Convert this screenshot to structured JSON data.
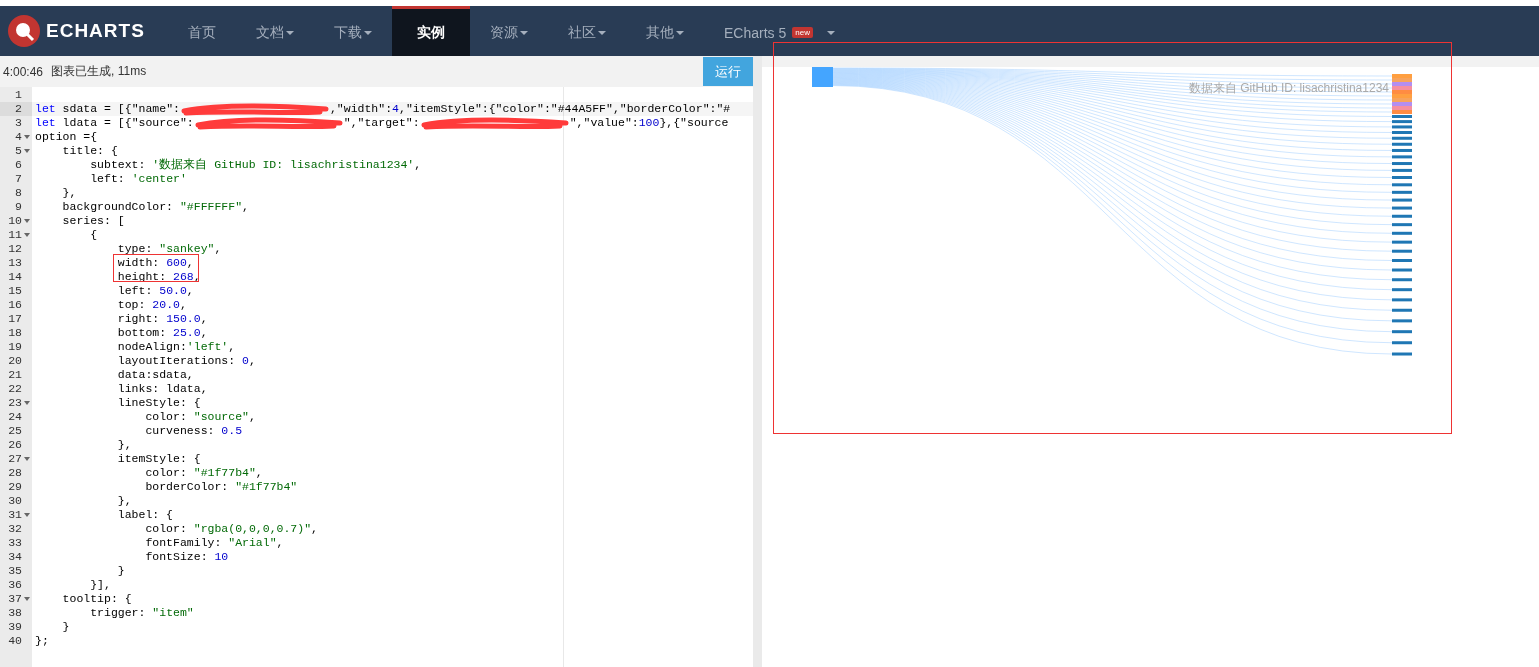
{
  "nav": {
    "logo": "ECHARTS",
    "items": [
      {
        "label": "首页",
        "dropdown": false,
        "selected": false
      },
      {
        "label": "文档",
        "dropdown": true,
        "selected": false
      },
      {
        "label": "下载",
        "dropdown": true,
        "selected": false
      },
      {
        "label": "实例",
        "dropdown": false,
        "selected": true
      },
      {
        "label": "资源",
        "dropdown": true,
        "selected": false
      },
      {
        "label": "社区",
        "dropdown": true,
        "selected": false
      },
      {
        "label": "其他",
        "dropdown": true,
        "selected": false
      },
      {
        "label": "ECharts 5",
        "badge": "new",
        "dropdown": true,
        "selected": false
      }
    ]
  },
  "status": {
    "time": "4:00:46",
    "message": "图表已生成, 11ms",
    "run_button": "运行"
  },
  "editor": {
    "lines": [
      {
        "n": "1",
        "fold": false,
        "active": false
      },
      {
        "n": "2",
        "fold": false,
        "active": true,
        "tokens": [
          {
            "kind": "kw",
            "text": "let"
          },
          {
            "kind": "plain",
            "text": " sdata = [{\"name\":"
          },
          {
            "kind": "redacted"
          },
          {
            "kind": "plain",
            "text": ",\"width\":"
          },
          {
            "kind": "num",
            "text": "4"
          },
          {
            "kind": "plain",
            "text": ",\"itemStyle\":{\"color\":\"#44A5FF\",\"borderColor\":\"#"
          }
        ]
      },
      {
        "n": "3",
        "fold": false,
        "active": false,
        "tokens": [
          {
            "kind": "kw",
            "text": "let"
          },
          {
            "kind": "plain",
            "text": " ldata = [{\"source\":"
          },
          {
            "kind": "redacted"
          },
          {
            "kind": "plain",
            "text": "\",\"target\":"
          },
          {
            "kind": "redacted"
          },
          {
            "kind": "plain",
            "text": "\",\"value\":"
          },
          {
            "kind": "num",
            "text": "100"
          },
          {
            "kind": "plain",
            "text": "},{\"source"
          }
        ]
      },
      {
        "n": "4",
        "fold": true,
        "active": false,
        "tokens": [
          {
            "kind": "plain",
            "text": "option ={"
          }
        ]
      },
      {
        "n": "5",
        "fold": true,
        "active": false,
        "tokens": [
          {
            "kind": "plain",
            "text": "    title: {"
          }
        ]
      },
      {
        "n": "6",
        "fold": false,
        "active": false,
        "tokens": [
          {
            "kind": "plain",
            "text": "        subtext: "
          },
          {
            "kind": "str",
            "text": "'数据来自 GitHub ID: lisachristina1234'"
          },
          {
            "kind": "plain",
            "text": ","
          }
        ]
      },
      {
        "n": "7",
        "fold": false,
        "active": false,
        "tokens": [
          {
            "kind": "plain",
            "text": "        left: "
          },
          {
            "kind": "str",
            "text": "'center'"
          }
        ]
      },
      {
        "n": "8",
        "fold": false,
        "active": false,
        "tokens": [
          {
            "kind": "plain",
            "text": "    },"
          }
        ]
      },
      {
        "n": "9",
        "fold": false,
        "active": false,
        "tokens": [
          {
            "kind": "plain",
            "text": "    backgroundColor: "
          },
          {
            "kind": "str",
            "text": "\"#FFFFFF\""
          },
          {
            "kind": "plain",
            "text": ","
          }
        ]
      },
      {
        "n": "10",
        "fold": true,
        "active": false,
        "tokens": [
          {
            "kind": "plain",
            "text": "    series: ["
          }
        ]
      },
      {
        "n": "11",
        "fold": true,
        "active": false,
        "tokens": [
          {
            "kind": "plain",
            "text": "        {"
          }
        ]
      },
      {
        "n": "12",
        "fold": false,
        "active": false,
        "tokens": [
          {
            "kind": "plain",
            "text": "            type: "
          },
          {
            "kind": "str",
            "text": "\"sankey\""
          },
          {
            "kind": "plain",
            "text": ","
          }
        ]
      },
      {
        "n": "13",
        "fold": false,
        "active": false,
        "tokens": [
          {
            "kind": "plain",
            "text": "            width: "
          },
          {
            "kind": "num",
            "text": "600"
          },
          {
            "kind": "plain",
            "text": ","
          }
        ]
      },
      {
        "n": "14",
        "fold": false,
        "active": false,
        "tokens": [
          {
            "kind": "plain",
            "text": "            height: "
          },
          {
            "kind": "num",
            "text": "268"
          },
          {
            "kind": "plain",
            "text": ","
          }
        ]
      },
      {
        "n": "15",
        "fold": false,
        "active": false,
        "tokens": [
          {
            "kind": "plain",
            "text": "            left: "
          },
          {
            "kind": "num",
            "text": "50.0"
          },
          {
            "kind": "plain",
            "text": ","
          }
        ]
      },
      {
        "n": "16",
        "fold": false,
        "active": false,
        "tokens": [
          {
            "kind": "plain",
            "text": "            top: "
          },
          {
            "kind": "num",
            "text": "20.0"
          },
          {
            "kind": "plain",
            "text": ","
          }
        ]
      },
      {
        "n": "17",
        "fold": false,
        "active": false,
        "tokens": [
          {
            "kind": "plain",
            "text": "            right: "
          },
          {
            "kind": "num",
            "text": "150.0"
          },
          {
            "kind": "plain",
            "text": ","
          }
        ]
      },
      {
        "n": "18",
        "fold": false,
        "active": false,
        "tokens": [
          {
            "kind": "plain",
            "text": "            bottom: "
          },
          {
            "kind": "num",
            "text": "25.0"
          },
          {
            "kind": "plain",
            "text": ","
          }
        ]
      },
      {
        "n": "19",
        "fold": false,
        "active": false,
        "tokens": [
          {
            "kind": "plain",
            "text": "            nodeAlign:"
          },
          {
            "kind": "str",
            "text": "'left'"
          },
          {
            "kind": "plain",
            "text": ","
          }
        ]
      },
      {
        "n": "20",
        "fold": false,
        "active": false,
        "tokens": [
          {
            "kind": "plain",
            "text": "            layoutIterations: "
          },
          {
            "kind": "num",
            "text": "0"
          },
          {
            "kind": "plain",
            "text": ","
          }
        ]
      },
      {
        "n": "21",
        "fold": false,
        "active": false,
        "tokens": [
          {
            "kind": "plain",
            "text": "            data:sdata,"
          }
        ]
      },
      {
        "n": "22",
        "fold": false,
        "active": false,
        "tokens": [
          {
            "kind": "plain",
            "text": "            links: ldata,"
          }
        ]
      },
      {
        "n": "23",
        "fold": true,
        "active": false,
        "tokens": [
          {
            "kind": "plain",
            "text": "            lineStyle: {"
          }
        ]
      },
      {
        "n": "24",
        "fold": false,
        "active": false,
        "tokens": [
          {
            "kind": "plain",
            "text": "                color: "
          },
          {
            "kind": "str",
            "text": "\"source\""
          },
          {
            "kind": "plain",
            "text": ","
          }
        ]
      },
      {
        "n": "25",
        "fold": false,
        "active": false,
        "tokens": [
          {
            "kind": "plain",
            "text": "                curveness: "
          },
          {
            "kind": "num",
            "text": "0.5"
          }
        ]
      },
      {
        "n": "26",
        "fold": false,
        "active": false,
        "tokens": [
          {
            "kind": "plain",
            "text": "            },"
          }
        ]
      },
      {
        "n": "27",
        "fold": true,
        "active": false,
        "tokens": [
          {
            "kind": "plain",
            "text": "            itemStyle: {"
          }
        ]
      },
      {
        "n": "28",
        "fold": false,
        "active": false,
        "tokens": [
          {
            "kind": "plain",
            "text": "                color: "
          },
          {
            "kind": "str",
            "text": "\"#1f77b4\""
          },
          {
            "kind": "plain",
            "text": ","
          }
        ]
      },
      {
        "n": "29",
        "fold": false,
        "active": false,
        "tokens": [
          {
            "kind": "plain",
            "text": "                borderColor: "
          },
          {
            "kind": "str",
            "text": "\"#1f77b4\""
          }
        ]
      },
      {
        "n": "30",
        "fold": false,
        "active": false,
        "tokens": [
          {
            "kind": "plain",
            "text": "            },"
          }
        ]
      },
      {
        "n": "31",
        "fold": true,
        "active": false,
        "tokens": [
          {
            "kind": "plain",
            "text": "            label: {"
          }
        ]
      },
      {
        "n": "32",
        "fold": false,
        "active": false,
        "tokens": [
          {
            "kind": "plain",
            "text": "                color: "
          },
          {
            "kind": "str",
            "text": "\"rgba(0,0,0,0.7)\""
          },
          {
            "kind": "plain",
            "text": ","
          }
        ]
      },
      {
        "n": "33",
        "fold": false,
        "active": false,
        "tokens": [
          {
            "kind": "plain",
            "text": "                fontFamily: "
          },
          {
            "kind": "str",
            "text": "\"Arial\""
          },
          {
            "kind": "plain",
            "text": ","
          }
        ]
      },
      {
        "n": "34",
        "fold": false,
        "active": false,
        "tokens": [
          {
            "kind": "plain",
            "text": "                fontSize: "
          },
          {
            "kind": "num",
            "text": "10"
          }
        ]
      },
      {
        "n": "35",
        "fold": false,
        "active": false,
        "tokens": [
          {
            "kind": "plain",
            "text": "            }"
          }
        ]
      },
      {
        "n": "36",
        "fold": false,
        "active": false,
        "tokens": [
          {
            "kind": "plain",
            "text": "        }],"
          }
        ]
      },
      {
        "n": "37",
        "fold": true,
        "active": false,
        "tokens": [
          {
            "kind": "plain",
            "text": "    tooltip: {"
          }
        ]
      },
      {
        "n": "38",
        "fold": false,
        "active": false,
        "tokens": [
          {
            "kind": "plain",
            "text": "        trigger: "
          },
          {
            "kind": "str",
            "text": "\"item\""
          }
        ]
      },
      {
        "n": "39",
        "fold": false,
        "active": false,
        "tokens": [
          {
            "kind": "plain",
            "text": "    }"
          }
        ]
      },
      {
        "n": "40",
        "fold": false,
        "active": false,
        "tokens": [
          {
            "kind": "plain",
            "text": "};"
          }
        ]
      }
    ]
  },
  "chart": {
    "subtitle": "数据来自 GitHub ID: lisachristina1234"
  }
}
